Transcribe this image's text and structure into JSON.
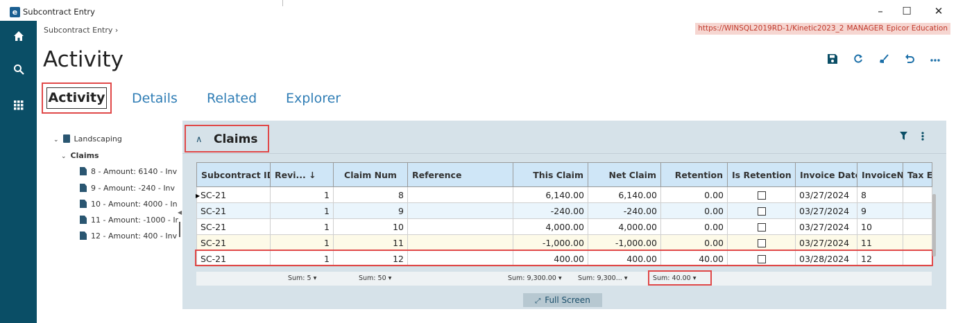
{
  "window": {
    "title": "Subcontract Entry",
    "minimize": "–",
    "maximize": "☐",
    "close": "✕"
  },
  "rail": {
    "home": "⌂",
    "search": "⚲",
    "apps": "⋮⋮"
  },
  "header": {
    "breadcrumb": "Subcontract Entry ›",
    "server": "https://WINSQL2019RD-1/Kinetic2023_2",
    "user": "MANAGER",
    "company": "Epicor Education",
    "page_title": "Activity"
  },
  "tabs": [
    "Activity",
    "Details",
    "Related",
    "Explorer"
  ],
  "tree": {
    "root": "Landscaping",
    "group": "Claims",
    "items": [
      "8 - Amount: 6140 - Inv",
      "9 - Amount: -240 - Inv",
      "10 - Amount: 4000 - In",
      "11 - Amount: -1000 - Ir",
      "12 - Amount: 400 - Inv"
    ]
  },
  "panel": {
    "title": "Claims",
    "fullscreen_label": "Full Screen"
  },
  "grid": {
    "columns": [
      "Subcontract ID",
      "Revi... ↓",
      "Claim Num",
      "Reference",
      "This Claim",
      "Net Claim",
      "Retention",
      "Is Retention",
      "Invoice Date",
      "InvoiceN...",
      "Tax E"
    ],
    "rows": [
      {
        "id": "SC-21",
        "rev": "1",
        "claim": "8",
        "ref": "",
        "this": "6,140.00",
        "net": "6,140.00",
        "ret": "0.00",
        "is_ret": false,
        "date": "03/27/2024",
        "inv": "8",
        "tax": ""
      },
      {
        "id": "SC-21",
        "rev": "1",
        "claim": "9",
        "ref": "",
        "this": "-240.00",
        "net": "-240.00",
        "ret": "0.00",
        "is_ret": false,
        "date": "03/27/2024",
        "inv": "9",
        "tax": ""
      },
      {
        "id": "SC-21",
        "rev": "1",
        "claim": "10",
        "ref": "",
        "this": "4,000.00",
        "net": "4,000.00",
        "ret": "0.00",
        "is_ret": false,
        "date": "03/27/2024",
        "inv": "10",
        "tax": ""
      },
      {
        "id": "SC-21",
        "rev": "1",
        "claim": "11",
        "ref": "",
        "this": "-1,000.00",
        "net": "-1,000.00",
        "ret": "0.00",
        "is_ret": false,
        "date": "03/27/2024",
        "inv": "11",
        "tax": ""
      },
      {
        "id": "SC-21",
        "rev": "1",
        "claim": "12",
        "ref": "",
        "this": "400.00",
        "net": "400.00",
        "ret": "40.00",
        "is_ret": false,
        "date": "03/28/2024",
        "inv": "12",
        "tax": ""
      }
    ],
    "sums": [
      "Sum: 5 ▾",
      "Sum: 50 ▾",
      "Sum: 9,300.00 ▾",
      "Sum: 9,300... ▾",
      "Sum: 40.00 ▾"
    ]
  }
}
